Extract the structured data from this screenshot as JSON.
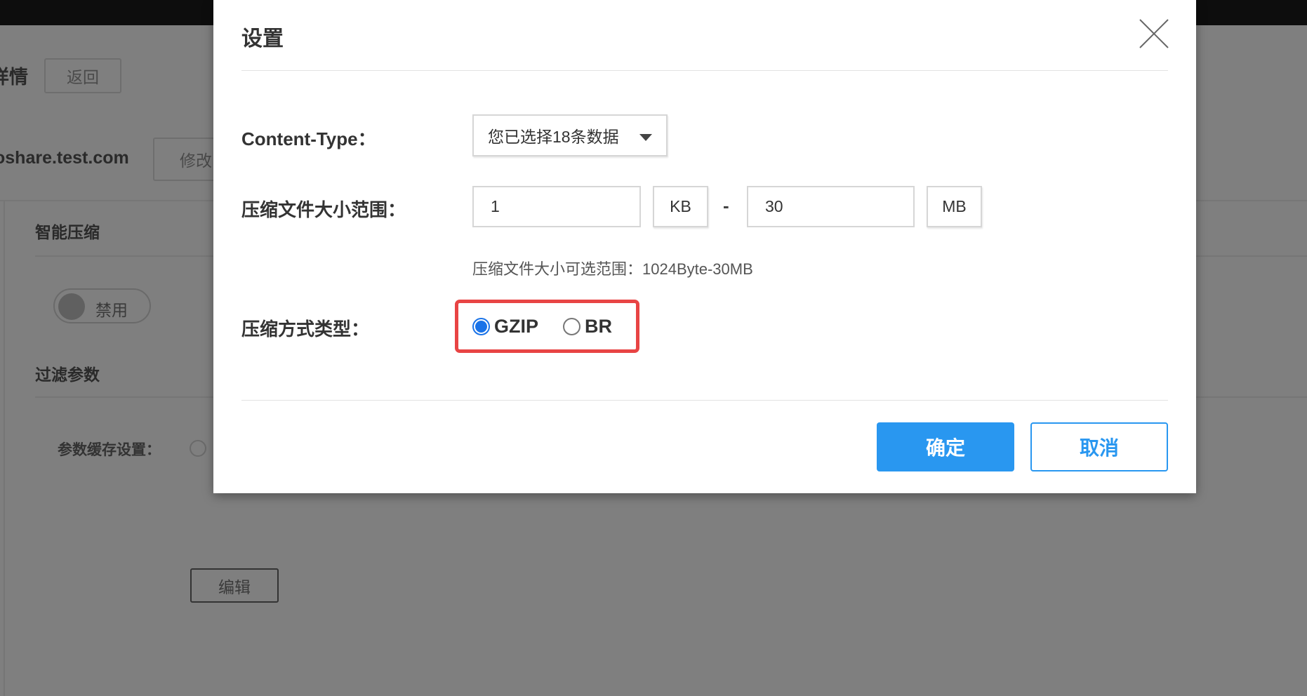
{
  "background": {
    "page_title": "详情",
    "back_label": "返回",
    "domain": "oshare.test.com",
    "modify_label": "修改",
    "section_smart_compress": "智能压缩",
    "toggle_label": "禁用",
    "section_filter_params": "过滤参数",
    "param_cache_label": "参数缓存设置：",
    "edit_label": "编辑"
  },
  "dialog": {
    "title": "设置",
    "content_type_label": "Content-Type：",
    "content_type_value": "您已选择18条数据",
    "size_range_label": "压缩文件大小范围：",
    "min_value": "1",
    "min_unit": "KB",
    "separator": "-",
    "max_value": "30",
    "max_unit": "MB",
    "size_hint": "压缩文件大小可选范围：1024Byte-30MB",
    "method_label": "压缩方式类型：",
    "methods": [
      {
        "label": "GZIP",
        "checked": true
      },
      {
        "label": "BR",
        "checked": false
      }
    ],
    "confirm_label": "确定",
    "cancel_label": "取消"
  },
  "colors": {
    "primary": "#2997f0",
    "highlight": "#e84444"
  }
}
